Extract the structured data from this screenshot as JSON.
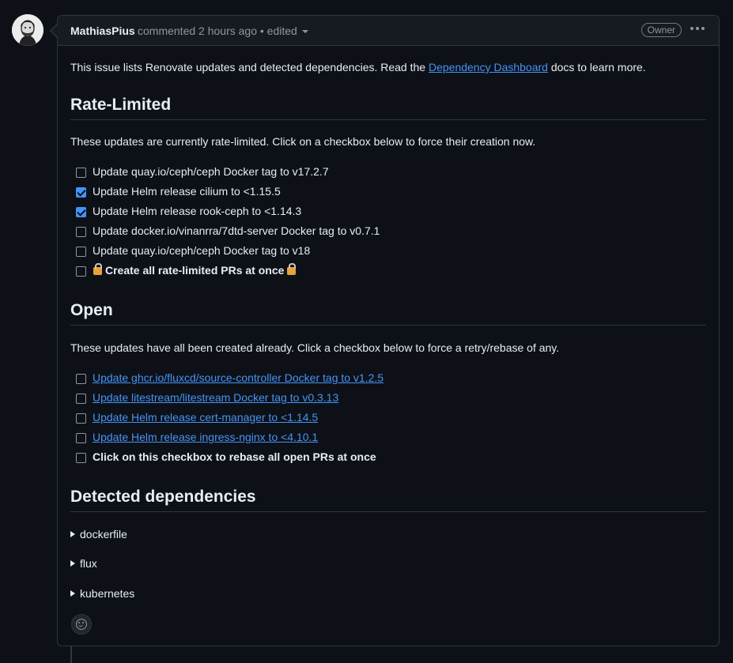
{
  "comment": {
    "author": "MathiasPius",
    "meta": "commented 2 hours ago • edited",
    "badge": "Owner",
    "intro_before": "This issue lists Renovate updates and detected dependencies. Read the",
    "intro_link": "Dependency Dashboard",
    "intro_after": "docs to learn more."
  },
  "rate_limited": {
    "heading": "Rate-Limited",
    "description": "These updates are currently rate-limited. Click on a checkbox below to force their creation now.",
    "items": [
      {
        "label": "Update quay.io/ceph/ceph Docker tag to v17.2.7",
        "checked": false
      },
      {
        "label": "Update Helm release cilium to <1.15.5",
        "checked": true
      },
      {
        "label": "Update Helm release rook-ceph to <1.14.3",
        "checked": true
      },
      {
        "label": "Update docker.io/vinanrra/7dtd-server Docker tag to v0.7.1",
        "checked": false
      },
      {
        "label": "Update quay.io/ceph/ceph Docker tag to v18",
        "checked": false
      }
    ],
    "create_all_label": "Create all rate-limited PRs at once",
    "create_all_icon": "lock-icon"
  },
  "open": {
    "heading": "Open",
    "description": "These updates have all been created already. Click a checkbox below to force a retry/rebase of any.",
    "items": [
      {
        "label": "Update ghcr.io/fluxcd/source-controller Docker tag to v1.2.5",
        "checked": false
      },
      {
        "label": "Update litestream/litestream Docker tag to v0.3.13",
        "checked": false
      },
      {
        "label": "Update Helm release cert-manager to <1.14.5",
        "checked": false
      },
      {
        "label": "Update Helm release ingress-nginx to <4.10.1",
        "checked": false
      }
    ],
    "rebase_all_label": "Click on this checkbox to rebase all open PRs at once"
  },
  "detected": {
    "heading": "Detected dependencies",
    "sections": [
      "dockerfile",
      "flux",
      "kubernetes"
    ]
  },
  "colors": {
    "background": "#0d1117",
    "link": "#4493f8",
    "checkbox_checked": "#4493f8",
    "muted": "#8d96a0"
  }
}
